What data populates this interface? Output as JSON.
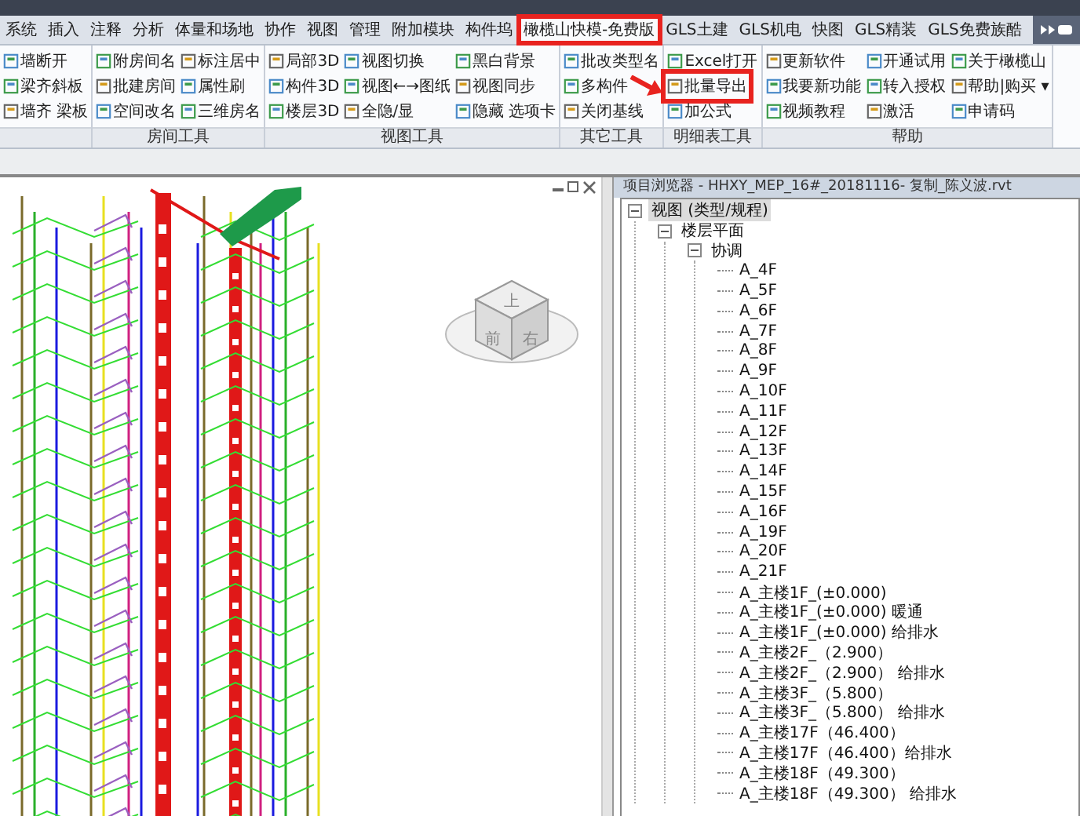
{
  "tabs": [
    {
      "label": "系统",
      "selected": false,
      "highlighted": false
    },
    {
      "label": "插入",
      "selected": false,
      "highlighted": false
    },
    {
      "label": "注释",
      "selected": false,
      "highlighted": false
    },
    {
      "label": "分析",
      "selected": false,
      "highlighted": false
    },
    {
      "label": "体量和场地",
      "selected": false,
      "highlighted": false
    },
    {
      "label": "协作",
      "selected": false,
      "highlighted": false
    },
    {
      "label": "视图",
      "selected": false,
      "highlighted": false
    },
    {
      "label": "管理",
      "selected": false,
      "highlighted": false
    },
    {
      "label": "附加模块",
      "selected": false,
      "highlighted": false
    },
    {
      "label": "构件坞",
      "selected": false,
      "highlighted": false
    },
    {
      "label": "橄榄山快模-免费版",
      "selected": true,
      "highlighted": true
    },
    {
      "label": "GLS土建",
      "selected": false,
      "highlighted": false
    },
    {
      "label": "GLS机电",
      "selected": false,
      "highlighted": false
    },
    {
      "label": "快图",
      "selected": false,
      "highlighted": false
    },
    {
      "label": "GLS精装",
      "selected": false,
      "highlighted": false
    },
    {
      "label": "GLS免费族酷",
      "selected": false,
      "highlighted": false
    }
  ],
  "ribbon_groups": [
    {
      "columns": [
        [
          {
            "label": "墙断开",
            "highlighted": false
          },
          {
            "label": "梁齐斜板",
            "highlighted": false
          },
          {
            "label": "墙齐 梁板",
            "highlighted": false
          }
        ]
      ]
    },
    {
      "label": "房间工具",
      "columns": [
        [
          {
            "label": "附房间名",
            "highlighted": false
          },
          {
            "label": "批建房间",
            "highlighted": false
          },
          {
            "label": "空间改名",
            "highlighted": false
          }
        ],
        [
          {
            "label": "标注居中",
            "highlighted": false
          },
          {
            "label": "属性刷",
            "highlighted": false
          },
          {
            "label": "三维房名",
            "highlighted": false
          }
        ]
      ]
    },
    {
      "label": "视图工具",
      "columns": [
        [
          {
            "label": "局部3D",
            "highlighted": false
          },
          {
            "label": "构件3D",
            "highlighted": false
          },
          {
            "label": "楼层3D",
            "highlighted": false
          }
        ],
        [
          {
            "label": "视图切换",
            "highlighted": false
          },
          {
            "label": "视图←→图纸",
            "highlighted": false
          },
          {
            "label": "全隐/显",
            "highlighted": false
          }
        ],
        [
          {
            "label": "黑白背景",
            "highlighted": false
          },
          {
            "label": "视图同步",
            "highlighted": false
          },
          {
            "label": "隐藏 选项卡",
            "highlighted": false
          }
        ]
      ]
    },
    {
      "label": "其它工具",
      "columns": [
        [
          {
            "label": "批改类型名",
            "highlighted": false
          },
          {
            "label": "多构件",
            "highlighted": false
          },
          {
            "label": "关闭基线",
            "highlighted": false
          }
        ]
      ]
    },
    {
      "label": "明细表工具",
      "columns": [
        [
          {
            "label": "Excel打开",
            "highlighted": false
          },
          {
            "label": "批量导出",
            "highlighted": true
          },
          {
            "label": "加公式",
            "highlighted": false
          }
        ]
      ]
    },
    {
      "label": "帮助",
      "columns": [
        [
          {
            "label": "更新软件",
            "highlighted": false
          },
          {
            "label": "我要新功能",
            "highlighted": false
          },
          {
            "label": "视频教程",
            "highlighted": false
          }
        ],
        [
          {
            "label": "开通试用",
            "highlighted": false
          },
          {
            "label": "转入授权",
            "highlighted": false
          },
          {
            "label": "激活",
            "highlighted": false
          }
        ],
        [
          {
            "label": "关于橄榄山",
            "highlighted": false
          },
          {
            "label": "帮助|购买 ▾",
            "highlighted": false
          },
          {
            "label": "申请码",
            "highlighted": false
          }
        ]
      ]
    }
  ],
  "view_cube": {
    "top": "上",
    "front": "前",
    "right": "右"
  },
  "project_browser": {
    "title": "项目浏览器 - HHXY_MEP_16#_20181116- 复制_陈义波.rvt",
    "tree": [
      {
        "label": "视图 (类型/规程)",
        "selected": true,
        "expanded": true,
        "children": [
          {
            "label": "楼层平面",
            "selected": false,
            "expanded": true,
            "children": [
              {
                "label": "协调",
                "selected": false,
                "expanded": true,
                "children": [
                  {
                    "label": "A_4F",
                    "selected": false
                  },
                  {
                    "label": "A_5F",
                    "selected": false
                  },
                  {
                    "label": "A_6F",
                    "selected": false
                  },
                  {
                    "label": "A_7F",
                    "selected": false
                  },
                  {
                    "label": "A_8F",
                    "selected": false
                  },
                  {
                    "label": "A_9F",
                    "selected": false
                  },
                  {
                    "label": "A_10F",
                    "selected": false
                  },
                  {
                    "label": "A_11F",
                    "selected": false
                  },
                  {
                    "label": "A_12F",
                    "selected": false
                  },
                  {
                    "label": "A_13F",
                    "selected": false
                  },
                  {
                    "label": "A_14F",
                    "selected": false
                  },
                  {
                    "label": "A_15F",
                    "selected": false
                  },
                  {
                    "label": "A_16F",
                    "selected": false
                  },
                  {
                    "label": "A_19F",
                    "selected": false
                  },
                  {
                    "label": "A_20F",
                    "selected": false
                  },
                  {
                    "label": "A_21F",
                    "selected": false
                  },
                  {
                    "label": "A_主楼1F_(±0.000)",
                    "selected": false
                  },
                  {
                    "label": "A_主楼1F_(±0.000) 暖通",
                    "selected": false
                  },
                  {
                    "label": "A_主楼1F_(±0.000) 给排水",
                    "selected": false
                  },
                  {
                    "label": "A_主楼2F_（2.900）",
                    "selected": false
                  },
                  {
                    "label": "A_主楼2F_（2.900） 给排水",
                    "selected": false
                  },
                  {
                    "label": "A_主楼3F_（5.800）",
                    "selected": false
                  },
                  {
                    "label": "A_主楼3F_（5.800） 给排水",
                    "selected": false
                  },
                  {
                    "label": "A_主楼17F（46.400）",
                    "selected": false
                  },
                  {
                    "label": "A_主楼17F（46.400）给排水",
                    "selected": false
                  },
                  {
                    "label": "A_主楼18F（49.300）",
                    "selected": false
                  },
                  {
                    "label": "A_主楼18F（49.300） 给排水",
                    "selected": false
                  }
                ]
              }
            ]
          }
        ]
      }
    ]
  }
}
